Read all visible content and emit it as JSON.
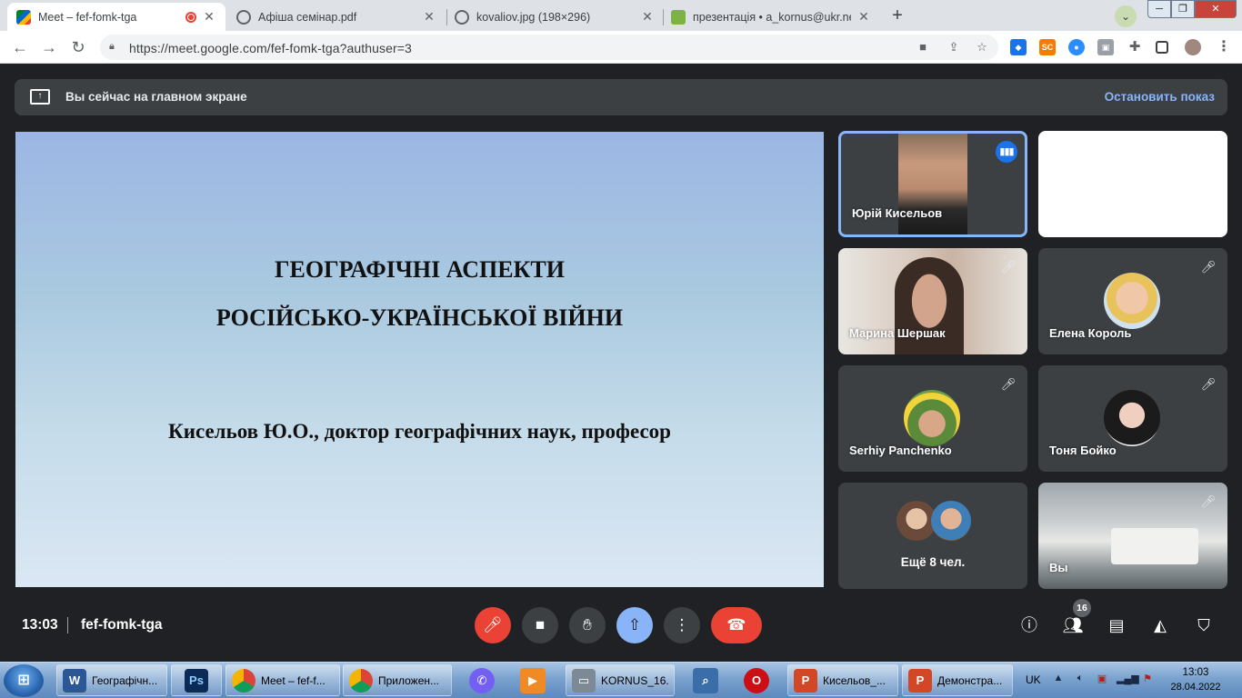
{
  "browser": {
    "tabs": [
      {
        "title": "Meet – fef-fomk-tga",
        "active": true,
        "recording": true
      },
      {
        "title": "Афіша семінар.pdf",
        "active": false
      },
      {
        "title": "kovaliov.jpg (198×296)",
        "active": false
      },
      {
        "title": "презентація • a_kornus@ukr.net",
        "active": false
      }
    ],
    "url": "https://meet.google.com/fef-fomk-tga?authuser=3",
    "extensions": [
      "SC"
    ]
  },
  "meet": {
    "presenting_text": "Вы сейчас на главном экране",
    "stop_presenting": "Остановить показ",
    "slide": {
      "title_line1": "ГЕОГРАФІЧНІ АСПЕКТИ",
      "title_line2": "РОСІЙСЬКО-УКРАЇНСЬКОЇ ВІЙНИ",
      "subtitle": "Кисельов Ю.О., доктор географічних наук, професор"
    },
    "participants": [
      {
        "name": "Юрій Кисельов",
        "speaking": true
      },
      {
        "name": "",
        "blank": true
      },
      {
        "name": "Марина Шершак",
        "muted": true
      },
      {
        "name": "Елена Король",
        "muted": true
      },
      {
        "name": "Serhiy Panchenko",
        "muted": true
      },
      {
        "name": "Тоня Бойко",
        "muted": true
      },
      {
        "name": "Ещё 8 чел."
      },
      {
        "name": "Вы",
        "muted": true
      }
    ],
    "time": "13:03",
    "meeting_code": "fef-fomk-tga",
    "people_count": "16"
  },
  "taskbar": {
    "items": [
      {
        "label": "Географічн...",
        "icon": "W",
        "color": "#2b5797"
      },
      {
        "label": "",
        "icon": "Ps",
        "color": "#0b2a57"
      },
      {
        "label": "Meet – fef-f...",
        "icon": "chrome",
        "color": "#db4437"
      },
      {
        "label": "Приложен...",
        "icon": "chrome",
        "color": "#db4437"
      },
      {
        "label": "KORNUS_16...",
        "icon": "drive",
        "color": "#7d8a96"
      },
      {
        "label": "Кисельов_...",
        "icon": "P",
        "color": "#d24726"
      },
      {
        "label": "Демонстра...",
        "icon": "P",
        "color": "#d24726"
      }
    ],
    "language": "UK",
    "time": "13:03",
    "date": "28.04.2022"
  }
}
